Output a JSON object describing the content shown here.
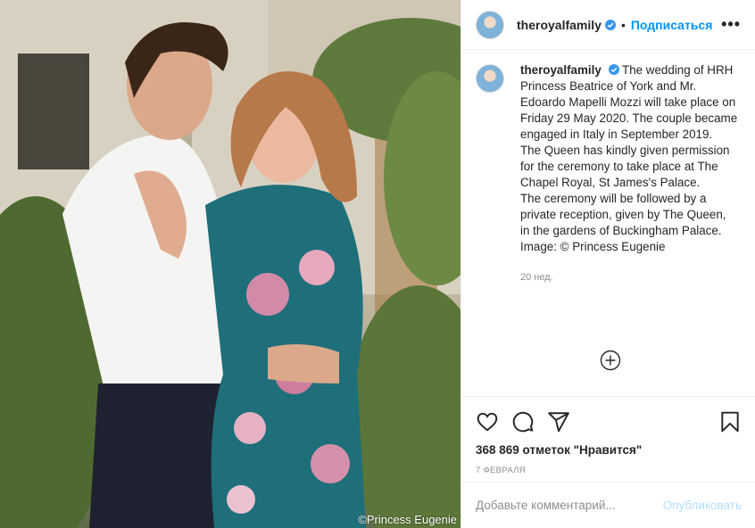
{
  "photo": {
    "credit": "©Princess Eugenie"
  },
  "post": {
    "username": "theroyalfamily",
    "separator": "•",
    "follow_label": "Подписаться",
    "more_label": "•••",
    "caption_lines": [
      "The wedding of HRH Princess Beatrice of York and Mr. Edoardo Mapelli Mozzi will take place on Friday 29 May 2020. The couple became engaged in Italy in September 2019.",
      "The Queen has kindly given permission for the ceremony to take place at The Chapel Royal, St James's Palace.",
      "The ceremony will be followed by a private reception, given by The Queen, in the gardens of Buckingham Palace.",
      "Image: © Princess Eugenie"
    ],
    "caption_time": "20 нед.",
    "likes": "368 869 отметок \"Нравится\"",
    "date": "7 ФЕВРАЛЯ"
  },
  "comment": {
    "placeholder": "Добавьте комментарий...",
    "publish_label": "Опубликовать"
  },
  "colors": {
    "accent": "#0095f6",
    "verified": "#3897f0",
    "muted": "#8e8e8e",
    "publish_disabled": "#b2dffc"
  },
  "icons": [
    "verified-badge-icon",
    "more-options-icon",
    "load-more-comments-icon",
    "heart-icon",
    "comment-icon",
    "share-icon",
    "bookmark-icon"
  ]
}
